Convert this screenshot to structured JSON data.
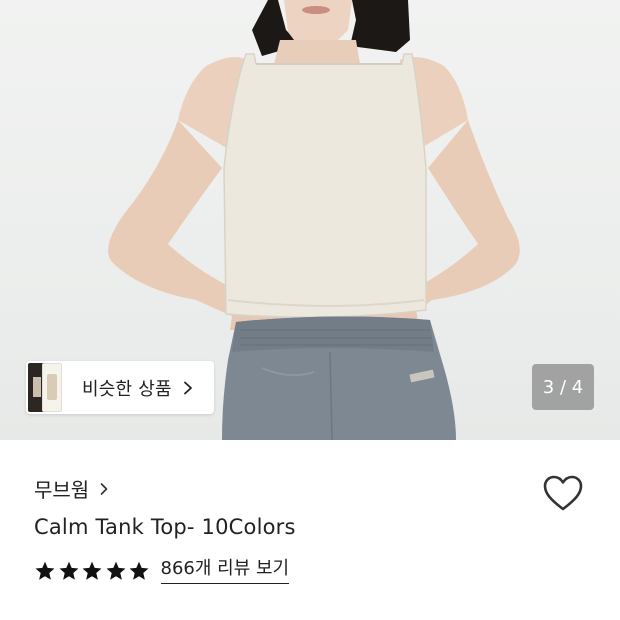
{
  "hero": {
    "similar_label": "비슷한 상품",
    "pager": "3 / 4",
    "image_alt": "model wearing tank top"
  },
  "product": {
    "brand": "무브웜",
    "title": "Calm Tank Top- 10Colors",
    "rating": 5,
    "max_rating": 5,
    "review_link": "866개 리뷰 보기"
  },
  "colors": {
    "text": "#222222",
    "star": "#111111",
    "pager_bg": "#767676",
    "top_color": "#ece8df",
    "pants_color": "#7e8892"
  },
  "icons": [
    "chevron-right-icon",
    "heart-icon",
    "star-icon"
  ]
}
